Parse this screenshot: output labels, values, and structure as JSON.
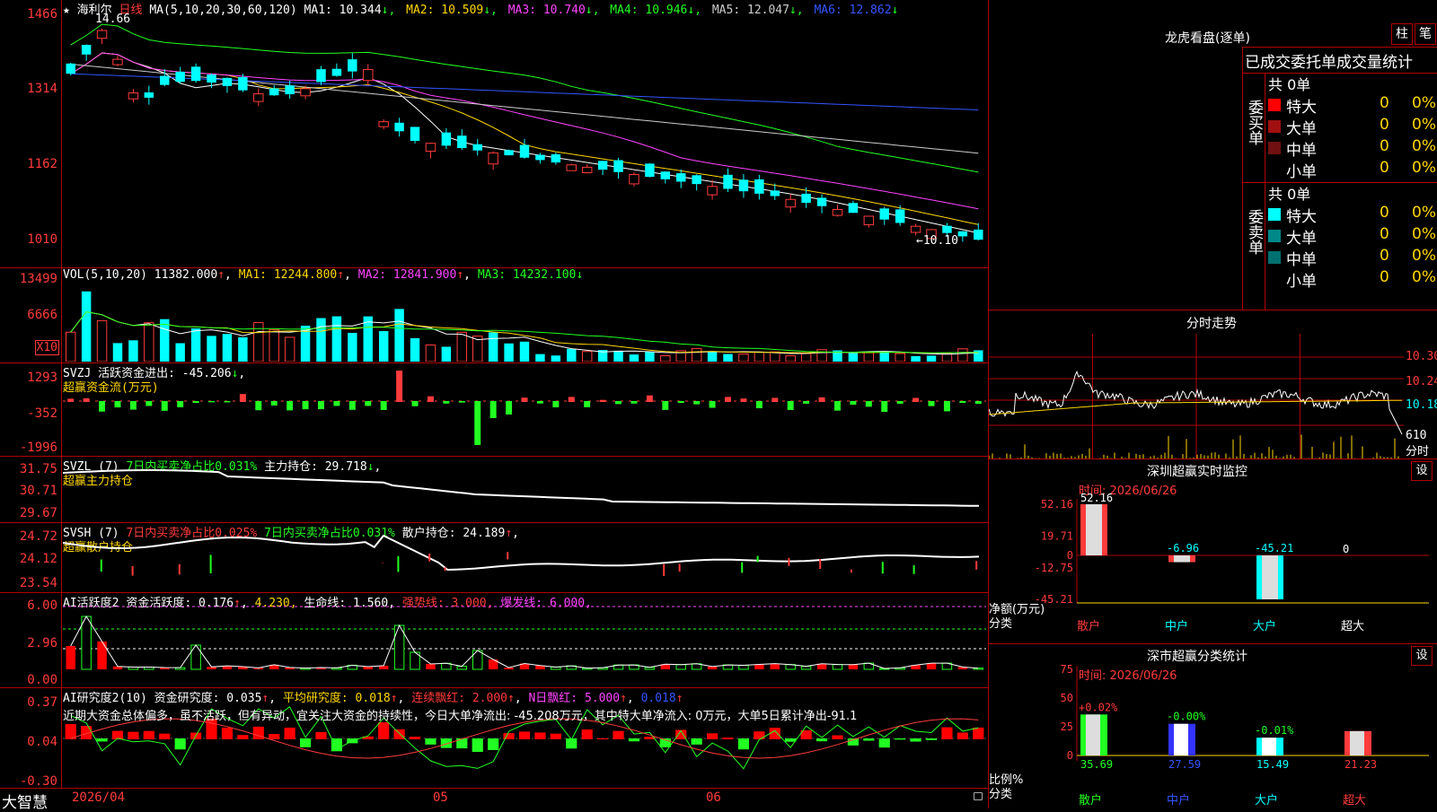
{
  "main": {
    "stock_name": "海利尔",
    "period": "日线",
    "ma_title": "MA(5,10,20,30,60,120)",
    "ma": [
      {
        "label": "MA1: 10.344",
        "arrow": "↓",
        "color": "#ffffff"
      },
      {
        "label": "MA2: 10.509",
        "arrow": "↓",
        "color": "#ffd700"
      },
      {
        "label": "MA3: 10.740",
        "arrow": "↓",
        "color": "#ff44ff"
      },
      {
        "label": "MA4: 10.946",
        "arrow": "↓",
        "color": "#22ff22"
      },
      {
        "label": "MA5: 12.047",
        "arrow": "↓",
        "color": "#cccccc"
      },
      {
        "label": "MA6: 12.862",
        "arrow": "↓",
        "color": "#3355ff"
      }
    ],
    "y_labels": [
      "1466",
      "1314",
      "1162",
      "1010"
    ],
    "high_label": "14.66",
    "low_label": "←10.10",
    "star": "★"
  },
  "vol": {
    "title": "VOL(5,10,20)",
    "value": "11382.000",
    "ma1": "MA1: 12244.800",
    "ma2": "MA2: 12841.900",
    "ma3": "MA3: 14232.100",
    "y_labels": [
      "13499",
      "6666"
    ],
    "unit": "X10"
  },
  "svzj": {
    "title": "SVZJ",
    "text": "活跃资金进出: -45.206",
    "sub": "超赢资金流(万元)",
    "y_labels": [
      "1293",
      "-352",
      "-1996"
    ]
  },
  "svzl": {
    "title": "SVZL (7)",
    "text1": "7日内买卖净占比0.031%",
    "text2": "主力持仓: 29.718",
    "sub": "超赢主力持仓",
    "y_labels": [
      "31.75",
      "30.71",
      "29.67"
    ]
  },
  "svsh": {
    "title": "SVSH (7)",
    "text1": "7日内买卖净占比0.025%",
    "text2": "7日内买卖净占比0.031%",
    "text3": "散户持仓: 24.189",
    "sub": "超赢散户持仓",
    "y_labels": [
      "24.72",
      "24.12",
      "23.54"
    ]
  },
  "ai1": {
    "title": "AI活跃度2",
    "t1": "资金活跃度: 0.176",
    "t2": "4.230,",
    "t3": "生命线: 1.560,",
    "t4": "强势线: 3.000,",
    "t5": "爆发线: 6.000,",
    "y_labels": [
      "6.00",
      "2.96",
      "0.00"
    ]
  },
  "ai2": {
    "title": "AI研究度2(10)",
    "t1": "资金研究度: 0.035",
    "t2": "平均研究度: 0.018",
    "t3": "连续飘红: 2.000",
    "t4": "N日飘红: 5.000",
    "t5": "0.018",
    "comment": "近期大资金总体偏多，虽不活跃，但有异动，宜关注大资金的持续性，今日大单净流出: -45.208万元，其中特大单净流入: 0万元，大单5日累计净出-91.1",
    "y_labels": [
      "0.37",
      "0.04",
      "-0.30"
    ]
  },
  "xaxis": {
    "labels": [
      "2026/04",
      "05",
      "06"
    ],
    "brand": "大智慧"
  },
  "lhb": {
    "title": "龙虎看盘(逐单)",
    "btn1": "柱",
    "btn2": "笔",
    "section": "已成交委托单成交量统计",
    "buy_label": "委买单",
    "sell_label": "委卖单",
    "buy_total": "共 0单",
    "sell_total": "共 0单",
    "buy_rows": [
      {
        "name": "特大",
        "vol": "0",
        "pct": "0%",
        "color": "#ff0000"
      },
      {
        "name": "大单",
        "vol": "0",
        "pct": "0%",
        "color": "#a01010"
      },
      {
        "name": "中单",
        "vol": "0",
        "pct": "0%",
        "color": "#701010"
      },
      {
        "name": "小单",
        "vol": "0",
        "pct": "0%",
        "color": ""
      }
    ],
    "sell_rows": [
      {
        "name": "特大",
        "vol": "0",
        "pct": "0%",
        "color": "#00ffff"
      },
      {
        "name": "大单",
        "vol": "0",
        "pct": "0%",
        "color": "#008888"
      },
      {
        "name": "中单",
        "vol": "0",
        "pct": "0%",
        "color": "#007070"
      },
      {
        "name": "小单",
        "vol": "0",
        "pct": "0%",
        "color": ""
      }
    ]
  },
  "intraday": {
    "title": "分时走势",
    "y_labels": [
      "10.30",
      "10.24",
      "10.18"
    ],
    "vol_label": "610",
    "sub": "分时"
  },
  "monitor": {
    "title": "深圳超赢实时监控",
    "gear": "设",
    "date": "时间: 2026/06/26",
    "y_labels": [
      "52.16",
      "19.71",
      "0",
      "-12.75",
      "-45.21"
    ],
    "unit": "净额(万元)",
    "axis_name": "分类",
    "categories": [
      "散户",
      "中户",
      "大户",
      "超大"
    ],
    "values": [
      52.16,
      -6.96,
      -45.21,
      0
    ],
    "value_labels": [
      "52.16",
      "-6.96",
      "-45.21",
      "0"
    ]
  },
  "stats": {
    "title": "深市超赢分类统计",
    "gear": "设",
    "date": "时间: 2026/06/26",
    "y_labels": [
      "75",
      "50",
      "25",
      "0"
    ],
    "unit": "比例%",
    "axis_name": "分类",
    "categories": [
      "散户",
      "中户",
      "大户",
      "超大"
    ],
    "values": [
      35.69,
      27.59,
      15.49,
      21.23
    ],
    "value_labels": [
      "35.69",
      "27.59",
      "15.49",
      "21.23"
    ],
    "change_labels": [
      "+0.02%",
      "-0.00%",
      "-0.01%",
      ""
    ]
  },
  "chart_data": [
    {
      "type": "bar",
      "title": "深圳超赢实时监控",
      "ylabel": "净额(万元)",
      "xlabel": "分类",
      "categories": [
        "散户",
        "中户",
        "大户",
        "超大"
      ],
      "values": [
        52.16,
        -6.96,
        -45.21,
        0
      ],
      "ylim": [
        -45.21,
        52.16
      ]
    },
    {
      "type": "bar",
      "title": "深市超赢分类统计",
      "ylabel": "比例%",
      "xlabel": "分类",
      "categories": [
        "散户",
        "中户",
        "大户",
        "超大"
      ],
      "values": [
        35.69,
        27.59,
        15.49,
        21.23
      ],
      "ylim": [
        0,
        75
      ]
    }
  ]
}
